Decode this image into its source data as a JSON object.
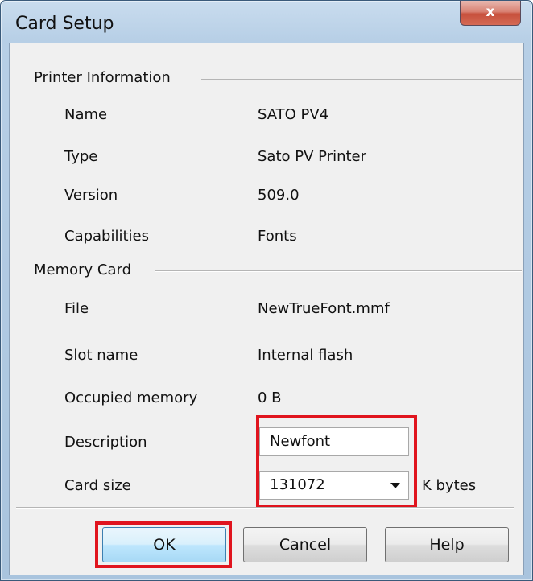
{
  "window": {
    "title": "Card Setup",
    "close_label": "x"
  },
  "printer_info": {
    "heading": "Printer Information",
    "rows": [
      {
        "label": "Name",
        "value": "SATO PV4"
      },
      {
        "label": "Type",
        "value": "Sato PV Printer"
      },
      {
        "label": "Version",
        "value": "509.0"
      },
      {
        "label": "Capabilities",
        "value": "Fonts"
      }
    ]
  },
  "memory_card": {
    "heading": "Memory Card",
    "rows": [
      {
        "label": "File",
        "value": "NewTrueFont.mmf"
      },
      {
        "label": "Slot name",
        "value": "Internal flash"
      },
      {
        "label": "Occupied memory",
        "value": "0 B"
      }
    ],
    "description_label": "Description",
    "description_value": "Newfont",
    "card_size_label": "Card size",
    "card_size_value": "131072",
    "card_size_unit": "K bytes"
  },
  "buttons": {
    "ok": "OK",
    "cancel": "Cancel",
    "help": "Help"
  },
  "colors": {
    "highlight": "#e0141e",
    "frame": "#b7cfe6"
  }
}
